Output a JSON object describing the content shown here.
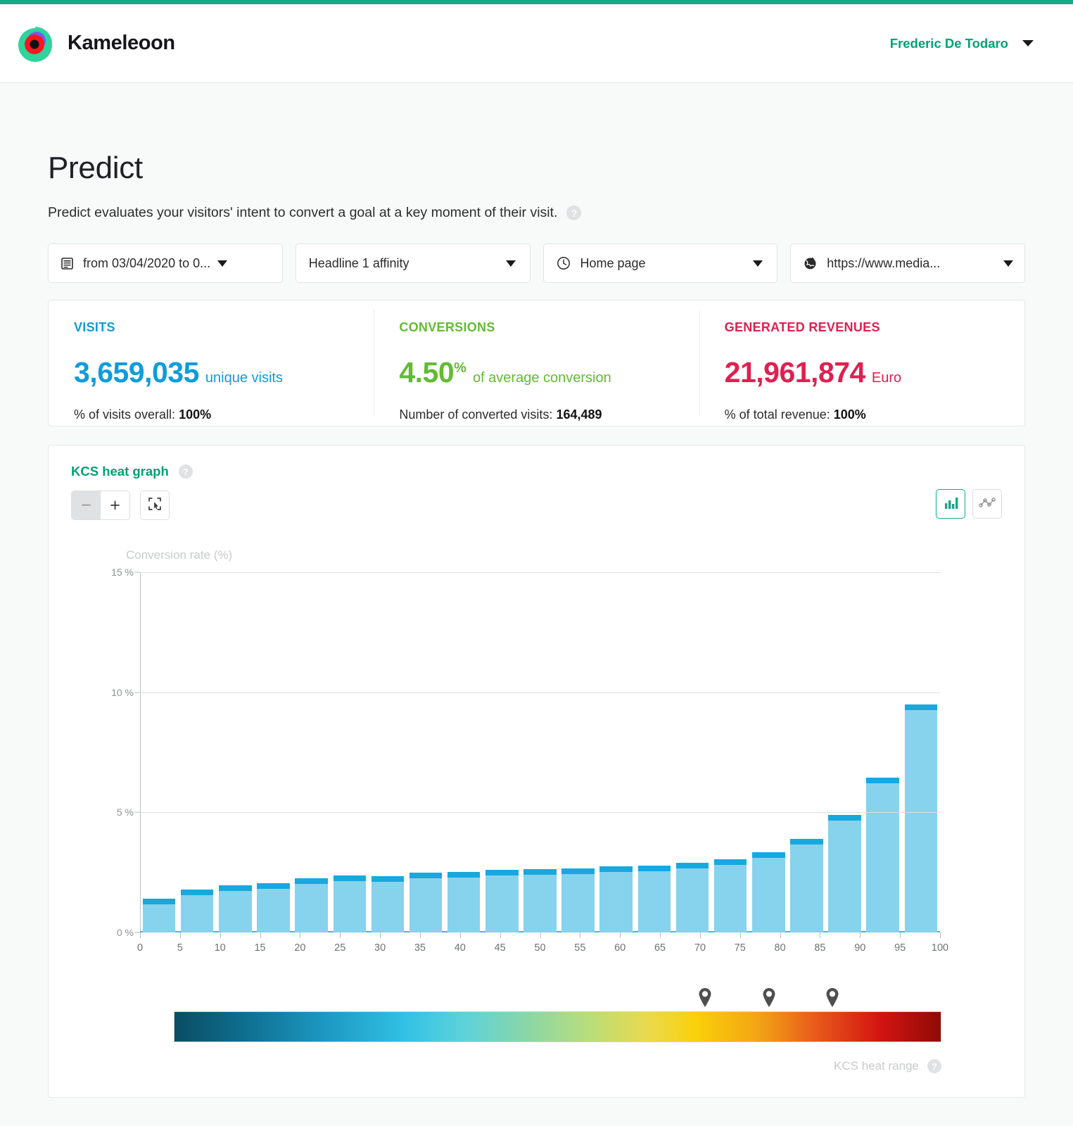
{
  "brand": {
    "name": "Kameleoon",
    "logo_icon": "kameleoon-logo"
  },
  "header": {
    "user_name": "Frederic De Todaro",
    "caret_icon": "chevron-down-icon"
  },
  "page": {
    "title": "Predict",
    "subtitle": "Predict evaluates your visitors' intent to convert a goal at a key moment of their visit.",
    "help_icon": "?"
  },
  "filters": [
    {
      "name": "date-range",
      "icon": "calendar-icon",
      "value": "from 03/04/2020 to 0..."
    },
    {
      "name": "goal",
      "icon": "none",
      "value": "Headline 1 affinity"
    },
    {
      "name": "page",
      "icon": "clock-icon",
      "value": "Home page"
    },
    {
      "name": "site-url",
      "icon": "globe-icon",
      "value": "https://www.media..."
    }
  ],
  "kpis": [
    {
      "title": "VISITS",
      "value": "3,659,035",
      "sup": "",
      "unit": "unique visits",
      "sub_label": "% of visits overall:",
      "sub_value": "100%",
      "color": "#0d9ddb"
    },
    {
      "title": "CONVERSIONS",
      "value": "4.50",
      "sup": "%",
      "unit": "of average conversion",
      "sub_label": "Number of converted visits:",
      "sub_value": "164,489",
      "color": "#63bb33"
    },
    {
      "title": "GENERATED REVENUES",
      "value": "21,961,874",
      "sup": "",
      "unit": "Euro",
      "sub_label": "% of total revenue:",
      "sub_value": "100%",
      "color": "#e02050"
    }
  ],
  "graph": {
    "title": "KCS heat graph",
    "help_icon": "?",
    "zoom_out_label": "−",
    "zoom_in_label": "+",
    "expand_icon": "expand-selection-icon",
    "bar_chart_icon": "bar-chart-icon",
    "line_chart_icon": "line-chart-icon",
    "heat_range_label": "KCS heat range",
    "heat_range_help_icon": "?",
    "markers": [
      83,
      93,
      103
    ]
  },
  "chart_data": {
    "type": "bar",
    "title": "KCS heat graph",
    "ylabel": "Conversion rate (%)",
    "xlabel": "",
    "ylim": [
      0,
      15
    ],
    "yticks": [
      0,
      5,
      10,
      15
    ],
    "ytick_labels": [
      "0 %",
      "5 %",
      "10 %",
      "15 %"
    ],
    "xlim": [
      0,
      100
    ],
    "xticks": [
      0,
      5,
      10,
      15,
      20,
      25,
      30,
      35,
      40,
      45,
      50,
      55,
      60,
      65,
      70,
      75,
      80,
      85,
      90,
      95,
      100
    ],
    "grid": true,
    "legend": "none",
    "bar_color": "#87d2ec",
    "bar_cap_color": "#17a8de",
    "categories": [
      "0-5",
      "5-10",
      "10-15",
      "15-20",
      "20-25",
      "25-30",
      "30-35",
      "35-40",
      "40-45",
      "45-50",
      "50-55",
      "55-60",
      "60-65",
      "65-70",
      "70-75",
      "75-80",
      "80-85",
      "85-90",
      "90-95",
      "95-100"
    ],
    "values": [
      1.4,
      1.8,
      1.95,
      2.05,
      2.25,
      2.38,
      2.35,
      2.5,
      2.52,
      2.62,
      2.65,
      2.68,
      2.75,
      2.78,
      2.9,
      3.05,
      3.35,
      3.9,
      4.88,
      6.45,
      9.5
    ],
    "heat_gradient": [
      "#0b4c63",
      "#0e6e8f",
      "#1d9ac4",
      "#31c0e4",
      "#5fd2d8",
      "#8ad6a6",
      "#b9dd7a",
      "#ecd94a",
      "#f9d009",
      "#f3a515",
      "#e8571c",
      "#d41512",
      "#8f0b06"
    ]
  }
}
